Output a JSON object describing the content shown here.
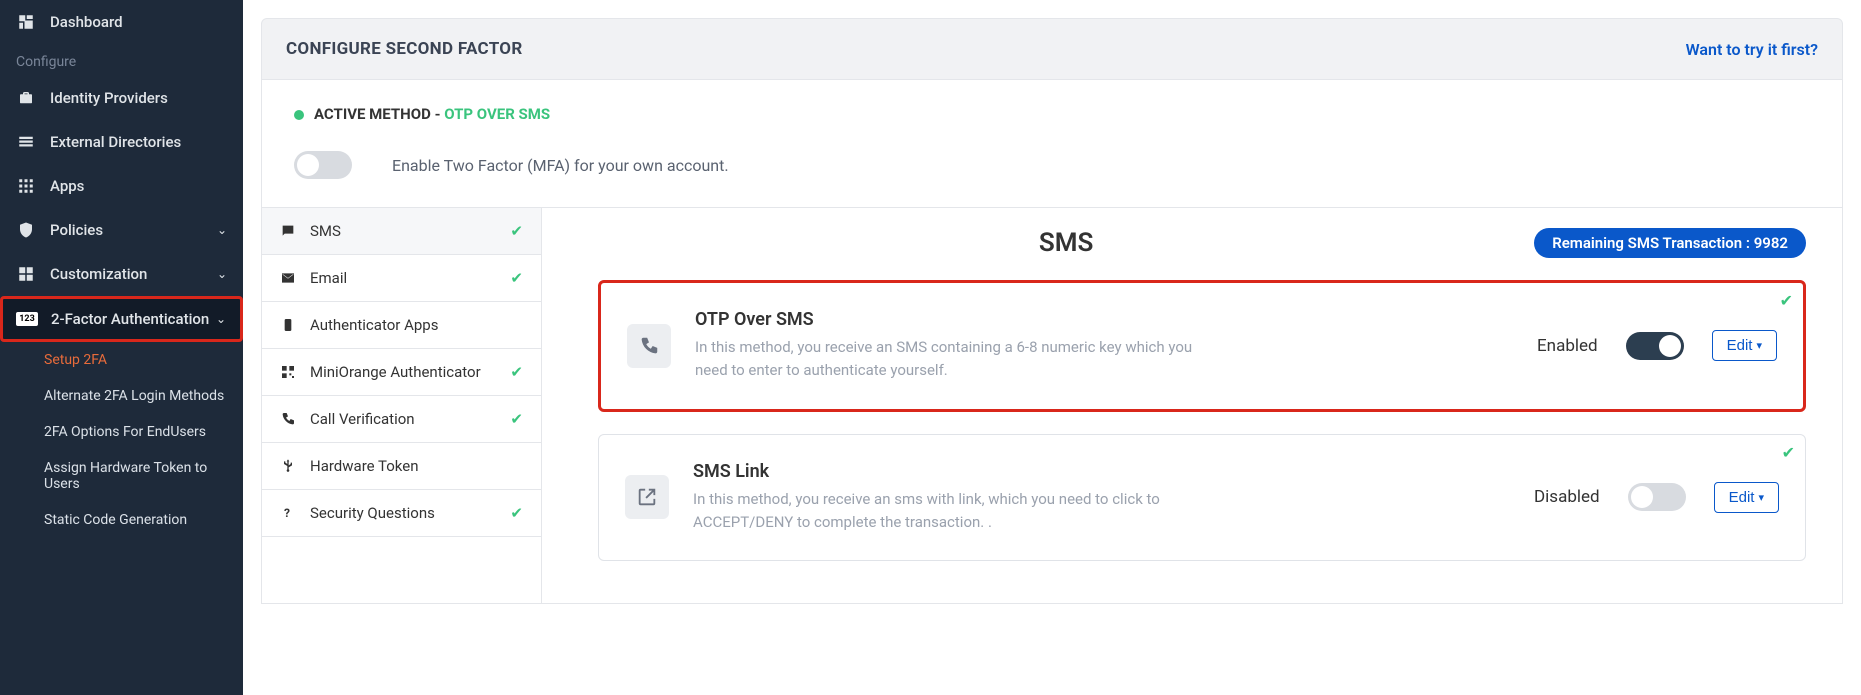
{
  "sidebar": {
    "dashboard": "Dashboard",
    "group_label": "Configure",
    "items": {
      "idp": "Identity Providers",
      "ext_dir": "External Directories",
      "apps": "Apps",
      "policies": "Policies",
      "customization": "Customization",
      "twofa": "2-Factor Authentication"
    },
    "sub": {
      "setup": "Setup 2FA",
      "alt": "Alternate 2FA Login Methods",
      "endusers": "2FA Options For EndUsers",
      "assign": "Assign Hardware Token to Users",
      "static": "Static Code Generation"
    }
  },
  "header": {
    "title": "CONFIGURE SECOND FACTOR",
    "try_link": "Want to try it first?"
  },
  "active_method": {
    "label": "ACTIVE METHOD - ",
    "value": "OTP OVER SMS"
  },
  "enable_row": {
    "text": "Enable Two Factor (MFA) for your own account."
  },
  "tabs": [
    {
      "label": "SMS",
      "checked": true,
      "active": true
    },
    {
      "label": "Email",
      "checked": true
    },
    {
      "label": "Authenticator Apps",
      "checked": false
    },
    {
      "label": "MiniOrange Authenticator",
      "checked": true
    },
    {
      "label": "Call Verification",
      "checked": true
    },
    {
      "label": "Hardware Token",
      "checked": false
    },
    {
      "label": "Security Questions",
      "checked": true
    }
  ],
  "panel": {
    "title": "SMS",
    "badge_prefix": "Remaining SMS Transaction : ",
    "badge_count": "9982"
  },
  "cards": [
    {
      "title": "OTP Over SMS",
      "desc": "In this method, you receive an SMS containing a 6-8 numeric key which you need to enter to authenticate yourself.",
      "status": "Enabled",
      "enabled": true,
      "edit": "Edit"
    },
    {
      "title": "SMS Link",
      "desc": "In this method, you receive an sms with link, which you need to click to ACCEPT/DENY to complete the transaction. .",
      "status": "Disabled",
      "enabled": false,
      "edit": "Edit"
    }
  ]
}
